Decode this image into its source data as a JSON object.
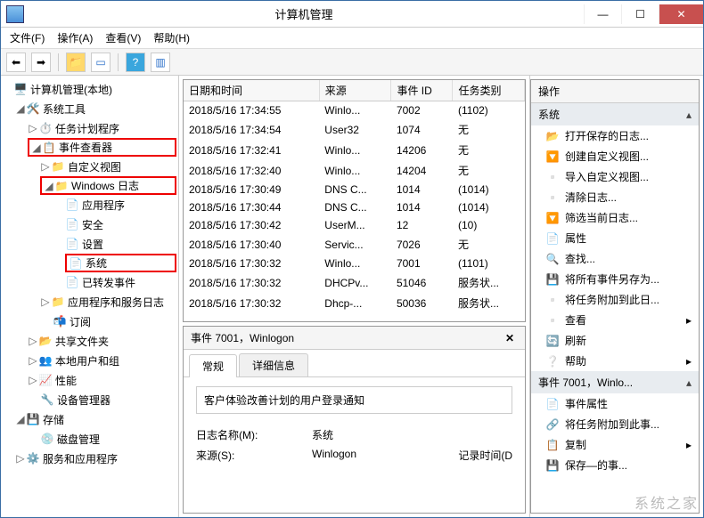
{
  "window": {
    "title": "计算机管理"
  },
  "menubar": [
    "文件(F)",
    "操作(A)",
    "查看(V)",
    "帮助(H)"
  ],
  "tree": {
    "root": "计算机管理(本地)",
    "systools": "系统工具",
    "taskscheduler": "任务计划程序",
    "eventviewer": "事件查看器",
    "customviews": "自定义视图",
    "winlogs": "Windows 日志",
    "app": "应用程序",
    "security": "安全",
    "setup": "设置",
    "system": "系统",
    "forwarded": "已转发事件",
    "appservlogs": "应用程序和服务日志",
    "subscriptions": "订阅",
    "shared": "共享文件夹",
    "localusers": "本地用户和组",
    "perf": "性能",
    "devmgr": "设备管理器",
    "storage": "存储",
    "diskmgr": "磁盘管理",
    "services": "服务和应用程序"
  },
  "grid": {
    "headers": [
      "日期和时间",
      "来源",
      "事件 ID",
      "任务类别"
    ],
    "rows": [
      [
        "2018/5/16 17:34:55",
        "Winlo...",
        "7002",
        "(1102)"
      ],
      [
        "2018/5/16 17:34:54",
        "User32",
        "1074",
        "无"
      ],
      [
        "2018/5/16 17:32:41",
        "Winlo...",
        "14206",
        "无"
      ],
      [
        "2018/5/16 17:32:40",
        "Winlo...",
        "14204",
        "无"
      ],
      [
        "2018/5/16 17:30:49",
        "DNS C...",
        "1014",
        "(1014)"
      ],
      [
        "2018/5/16 17:30:44",
        "DNS C...",
        "1014",
        "(1014)"
      ],
      [
        "2018/5/16 17:30:42",
        "UserM...",
        "12",
        "(10)"
      ],
      [
        "2018/5/16 17:30:40",
        "Servic...",
        "7026",
        "无"
      ],
      [
        "2018/5/16 17:30:32",
        "Winlo...",
        "7001",
        "(1101)"
      ],
      [
        "2018/5/16 17:30:32",
        "DHCPv...",
        "51046",
        "服务状..."
      ],
      [
        "2018/5/16 17:30:32",
        "Dhcp-...",
        "50036",
        "服务状..."
      ]
    ]
  },
  "detail": {
    "title": "事件 7001，Winlogon",
    "tabs": {
      "general": "常规",
      "details": "详细信息"
    },
    "message": "客户体验改善计划的用户登录通知",
    "lognameLbl": "日志名称(M):",
    "lognameVal": "系统",
    "sourceLbl": "来源(S):",
    "sourceVal": "Winlogon",
    "timeLbl": "记录时间(D"
  },
  "actions": {
    "header": "操作",
    "section1": "系统",
    "items1": [
      "打开保存的日志...",
      "创建自定义视图...",
      "导入自定义视图...",
      "清除日志...",
      "筛选当前日志...",
      "属性",
      "查找...",
      "将所有事件另存为...",
      "将任务附加到此日...",
      "查看",
      "刷新",
      "帮助"
    ],
    "section2": "事件 7001，Winlo...",
    "items2": [
      "事件属性",
      "将任务附加到此事...",
      "复制",
      "保存—的事..."
    ]
  },
  "watermark": "系统之家"
}
